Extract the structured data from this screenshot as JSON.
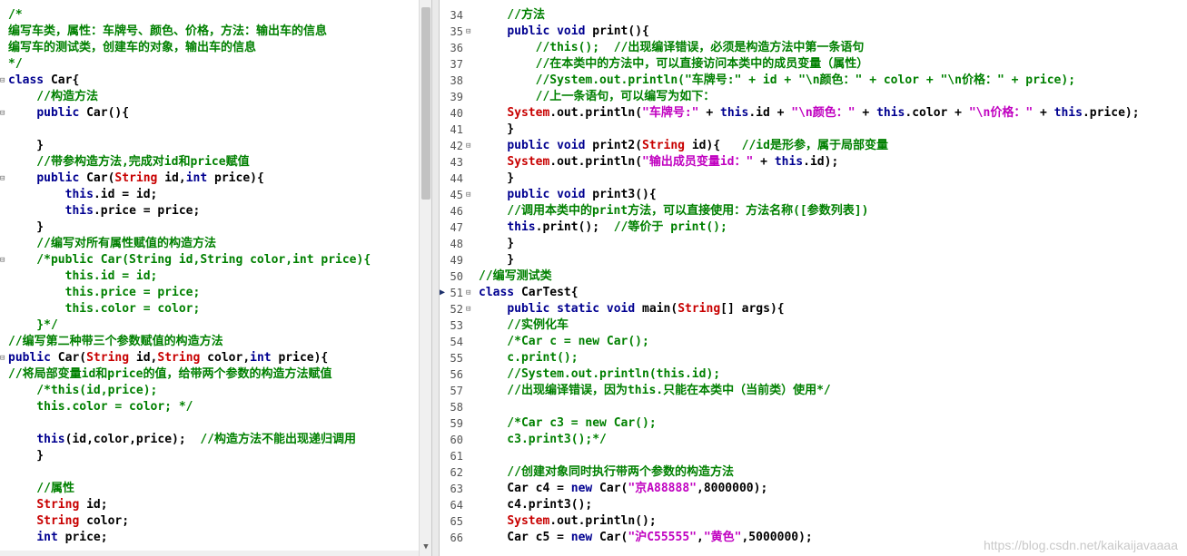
{
  "left_lines": [
    {
      "t": "/*",
      "c": "cm"
    },
    {
      "t": "编写车类，属性：车牌号、颜色、价格，方法：输出车的信息",
      "c": "cm"
    },
    {
      "t": "编写车的测试类，创建车的对象，输出车的信息",
      "c": "cm"
    },
    {
      "t": "*/",
      "c": "cm"
    },
    {
      "t": "class Car{"
    },
    {
      "t": "    //构造方法",
      "c": "cm"
    },
    {
      "t": "    public Car(){"
    },
    {
      "t": ""
    },
    {
      "t": "    }"
    },
    {
      "t": "    //带参构造方法,完成对id和price赋值",
      "c": "cm"
    },
    {
      "t": "    public Car(String id,int price){"
    },
    {
      "t": "        this.id = id;"
    },
    {
      "t": "        this.price = price;"
    },
    {
      "t": "    }"
    },
    {
      "t": "    //编写对所有属性赋值的构造方法",
      "c": "cm"
    },
    {
      "t": "    /*public Car(String id,String color,int price){",
      "c": "cm"
    },
    {
      "t": "        this.id = id;",
      "c": "cm"
    },
    {
      "t": "        this.price = price;",
      "c": "cm"
    },
    {
      "t": "        this.color = color;",
      "c": "cm"
    },
    {
      "t": "    }*/",
      "c": "cm"
    },
    {
      "t": "//编写第二种带三个参数赋值的构造方法",
      "c": "cm"
    },
    {
      "t": "public Car(String id,String color,int price){"
    },
    {
      "t": "//将局部变量id和price的值，给带两个参数的构造方法赋值",
      "c": "cm"
    },
    {
      "t": "    /*this(id,price);",
      "c": "cm"
    },
    {
      "t": "    this.color = color; */",
      "c": "cm"
    },
    {
      "t": ""
    },
    {
      "t": "    this(id,color,price);  //构造方法不能出现递归调用"
    },
    {
      "t": "    }"
    },
    {
      "t": ""
    },
    {
      "t": "    //属性",
      "c": "cm"
    },
    {
      "t": "    String id;"
    },
    {
      "t": "    String color;"
    },
    {
      "t": "    int price;"
    }
  ],
  "right_lines": [
    {
      "n": "34",
      "t": "    //方法",
      "c": "cm"
    },
    {
      "n": "35",
      "t": "    public void print(){"
    },
    {
      "n": "36",
      "t": "        //this();  //出现编译错误，必须是构造方法中第一条语句",
      "c": "cm"
    },
    {
      "n": "37",
      "t": "        //在本类中的方法中，可以直接访问本类中的成员变量（属性）",
      "c": "cm"
    },
    {
      "n": "38",
      "t": "        //System.out.println(\"车牌号:\" + id + \"\\n颜色：\" + color + \"\\n价格：\" + price);",
      "c": "cm"
    },
    {
      "n": "39",
      "t": "        //上一条语句，可以编写为如下：",
      "c": "cm"
    },
    {
      "n": "40",
      "t": "    System.out.println(\"车牌号:\" + this.id + \"\\n颜色：\" + this.color + \"\\n价格：\" + this.price);"
    },
    {
      "n": "41",
      "t": "    }"
    },
    {
      "n": "42",
      "t": "    public void print2(String id){   //id是形参，属于局部变量"
    },
    {
      "n": "43",
      "t": "    System.out.println(\"输出成员变量id：\" + this.id);"
    },
    {
      "n": "44",
      "t": "    }"
    },
    {
      "n": "45",
      "t": "    public void print3(){"
    },
    {
      "n": "46",
      "t": "    //调用本类中的print方法，可以直接使用：方法名称([参数列表])",
      "c": "cm"
    },
    {
      "n": "47",
      "t": "    this.print();  //等价于 print();"
    },
    {
      "n": "48",
      "t": "    }"
    },
    {
      "n": "49",
      "t": "    }"
    },
    {
      "n": "50",
      "t": "//编写测试类",
      "c": "cm"
    },
    {
      "n": "51",
      "t": "class CarTest{"
    },
    {
      "n": "52",
      "t": "    public static void main(String[] args){"
    },
    {
      "n": "53",
      "t": "    //实例化车",
      "c": "cm"
    },
    {
      "n": "54",
      "t": "    /*Car c = new Car();",
      "c": "cm"
    },
    {
      "n": "55",
      "t": "    c.print();",
      "c": "cm"
    },
    {
      "n": "56",
      "t": "    //System.out.println(this.id);",
      "c": "cm"
    },
    {
      "n": "57",
      "t": "    //出现编译错误，因为this.只能在本类中（当前类）使用*/",
      "c": "cm"
    },
    {
      "n": "58",
      "t": ""
    },
    {
      "n": "59",
      "t": "    /*Car c3 = new Car();",
      "c": "cm"
    },
    {
      "n": "60",
      "t": "    c3.print3();*/",
      "c": "cm"
    },
    {
      "n": "61",
      "t": ""
    },
    {
      "n": "62",
      "t": "    //创建对象同时执行带两个参数的构造方法",
      "c": "cm"
    },
    {
      "n": "63",
      "t": "    Car c4 = new Car(\"京A88888\",8000000);"
    },
    {
      "n": "64",
      "t": "    c4.print3();"
    },
    {
      "n": "65",
      "t": "    System.out.println();"
    },
    {
      "n": "66",
      "t": "    Car c5 = new Car(\"沪C55555\",\"黄色\",5000000);"
    }
  ],
  "watermark": "https://blog.csdn.net/kaikaijavaaaa",
  "fold_symbol": "⊟",
  "colors": {
    "comment": "#008000",
    "keyword": "#000090",
    "type": "#c80000",
    "string": "#c000c0"
  }
}
